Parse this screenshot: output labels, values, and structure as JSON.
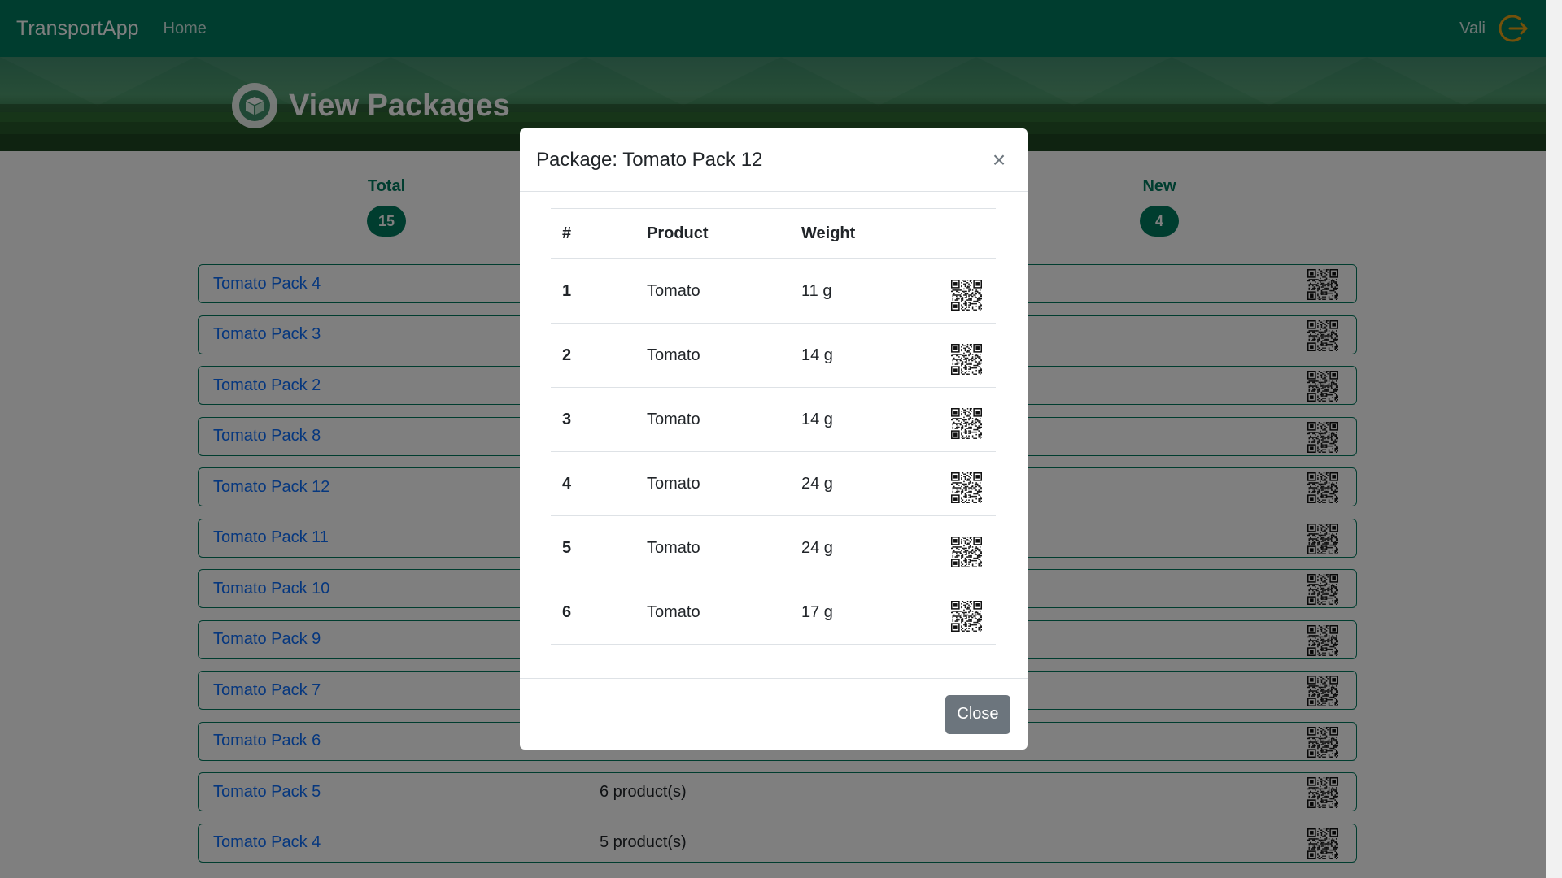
{
  "navbar": {
    "brand": "TransportApp",
    "home": "Home",
    "user": "Vali",
    "logout_icon": "logout-icon"
  },
  "banner": {
    "title": "View Packages",
    "icon": "package-icon"
  },
  "stats": {
    "total": {
      "label": "Total",
      "value": "15"
    },
    "new": {
      "label": "New",
      "value": "4"
    }
  },
  "packages": [
    {
      "name": "Tomato Pack 4",
      "count": ""
    },
    {
      "name": "Tomato Pack 3",
      "count": ""
    },
    {
      "name": "Tomato Pack 2",
      "count": ""
    },
    {
      "name": "Tomato Pack 8",
      "count": ""
    },
    {
      "name": "Tomato Pack 12",
      "count": ""
    },
    {
      "name": "Tomato Pack 11",
      "count": ""
    },
    {
      "name": "Tomato Pack 10",
      "count": ""
    },
    {
      "name": "Tomato Pack 9",
      "count": ""
    },
    {
      "name": "Tomato Pack 7",
      "count": ""
    },
    {
      "name": "Tomato Pack 6",
      "count": ""
    },
    {
      "name": "Tomato Pack 5",
      "count": "6 product(s)"
    },
    {
      "name": "Tomato Pack 4",
      "count": "5 product(s)"
    }
  ],
  "modal": {
    "title": "Package: Tomato Pack 12",
    "close_symbol": "×",
    "columns": {
      "num": "#",
      "product": "Product",
      "weight": "Weight"
    },
    "items": [
      {
        "num": "1",
        "product": "Tomato",
        "weight": "11 g"
      },
      {
        "num": "2",
        "product": "Tomato",
        "weight": "14 g"
      },
      {
        "num": "3",
        "product": "Tomato",
        "weight": "14 g"
      },
      {
        "num": "4",
        "product": "Tomato",
        "weight": "24 g"
      },
      {
        "num": "5",
        "product": "Tomato",
        "weight": "24 g"
      },
      {
        "num": "6",
        "product": "Tomato",
        "weight": "17 g"
      }
    ],
    "close_button": "Close"
  },
  "colors": {
    "brand": "#007a5e",
    "link": "#0d6efd",
    "secondary_button": "#6c757d"
  }
}
